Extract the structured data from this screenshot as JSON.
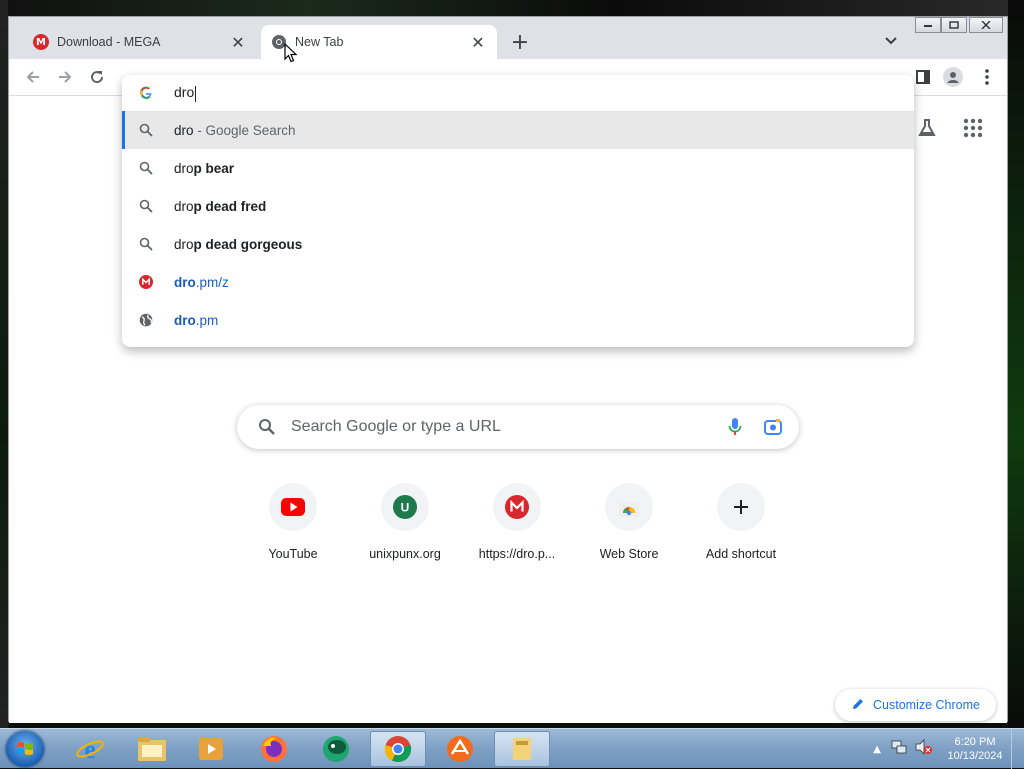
{
  "browser": {
    "tabs": [
      {
        "title": "Download - MEGA",
        "favicon": "mega-icon",
        "active": false
      },
      {
        "title": "New Tab",
        "favicon": "chrome-icon",
        "active": true
      }
    ],
    "new_tab_label": "+",
    "window_controls": [
      "minimize",
      "maximize",
      "close"
    ]
  },
  "omnibox": {
    "value": "dro",
    "suggestions": [
      {
        "icon": "search-icon",
        "prefix": "dro",
        "bold": "",
        "suffix": " - Google Search",
        "type": "search",
        "selected": true
      },
      {
        "icon": "search-icon",
        "prefix": "dro",
        "bold": "p bear",
        "suffix": "",
        "type": "search"
      },
      {
        "icon": "search-icon",
        "prefix": "dro",
        "bold": "p dead fred",
        "suffix": "",
        "type": "search"
      },
      {
        "icon": "search-icon",
        "prefix": "dro",
        "bold": "p dead gorgeous",
        "suffix": "",
        "type": "search"
      },
      {
        "icon": "mega-icon",
        "prefix": "dro",
        "bold": "",
        "suffix": ".pm/z",
        "type": "url"
      },
      {
        "icon": "globe-icon",
        "prefix": "dro",
        "bold": "",
        "suffix": ".pm",
        "type": "url"
      }
    ]
  },
  "ntp": {
    "search_placeholder": "Search Google or type a URL",
    "shortcuts": [
      {
        "label": "YouTube",
        "icon": "youtube-icon"
      },
      {
        "label": "unixpunx.org",
        "icon": "letter-u-icon"
      },
      {
        "label": "https://dro.p...",
        "icon": "mega-icon"
      },
      {
        "label": "Web Store",
        "icon": "webstore-icon"
      },
      {
        "label": "Add shortcut",
        "icon": "plus-icon"
      }
    ],
    "customize_label": "Customize Chrome"
  },
  "taskbar": {
    "apps": [
      "internet-explorer-icon",
      "file-explorer-icon",
      "media-player-icon",
      "firefox-icon",
      "browser-icon",
      "chrome-icon",
      "app-icon",
      "folder-icon"
    ],
    "time": "6:20 PM",
    "date": "10/13/2024"
  },
  "colors": {
    "accent": "#1a73e8",
    "mega_red": "#d9272e",
    "tab_strip": "#dee1e6"
  }
}
